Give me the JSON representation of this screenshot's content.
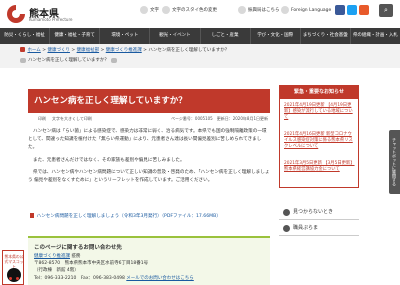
{
  "header": {
    "logo_name": "熊本県",
    "logo_en": "Kumamoto Prefecture",
    "util": [
      "文字",
      "文字のスタイ色の変更",
      "振興局はこちら",
      "Foreign Language"
    ],
    "search_icon": "magnifier-icon"
  },
  "gnav": [
    "防災・くらし・福祉",
    "健康・福祉・子育て",
    "環境・ペット",
    "観光・イベント",
    "しごと・産業",
    "学び・文化・国際",
    "まちづくり・社会基盤",
    "県の組織・計画・入札"
  ],
  "breadcrumb": {
    "items": [
      "ホーム",
      "健康づくり",
      "健康福祉部",
      "健康づくり推進課",
      "ハンセン病を正しく理解していますか？"
    ],
    "share_label": "ハンセン病を正しく理解していますか？"
  },
  "article": {
    "title": "ハンセン病を正しく理解していますか？",
    "meta_left": [
      "印刷",
      "文字を大きくして印刷"
    ],
    "meta_right": [
      "ページ番号：0005105",
      "更新日：2020年8月1日更新"
    ],
    "paragraphs": [
      "ハンセン病は「らい菌」による感染症で、感染力は非常に弱く、治る病気です。本県でも国の強制隔離政策の一環として、間違った知識を植付けた「無らい県運動」により、元患者さん達は長い間偏見差別に苦しめられてきました。",
      "また、元患者さんだけではなく、その家族も差別や偏見に苦しみました。",
      "県では、ハンセン病やハンセン病問題について正しい知識の普及・啓発のため、「ハンセン病を正しく理解しましょう 偏見や差別をなくすために」というリーフレットを作成しています。ご活用ください。"
    ],
    "pdf_link": "ハンセン病問題を正しく理解しましょう（令和3年3月発行）（PDFファイル：17.66MB）"
  },
  "contact": {
    "title": "このページに関するお問い合わせ先",
    "dept": "健康づくり推進課",
    "dept_suffix": "疫務",
    "address": "〒862-8570　熊本県熊本市中央区水前寺6丁目18番1号",
    "building": "（行政棟　新館 4階）",
    "tel": "Tel：096-333-2210　Fax：096-383-0498",
    "mail_link": "メールでのお問い合わせはこちら"
  },
  "sidebar": {
    "emergency_title": "緊急・重要なお知らせ",
    "emergency_items": [
      "2021年4月19日更新 【4月19日更新】感染が流行している地域について",
      "2021年4月16日更新 新型コロナウイルス感染症対策に係る熊本県リスクレベルについて",
      "2021年3月5日更新 【3月5日更新】熊本県経営講協力金について"
    ],
    "links": [
      "見つからないとき",
      "職員ぷらま"
    ]
  },
  "chat_tab": "チャットボットに質問する",
  "pref_banner": "熊本県の公式マスコット",
  "colors": {
    "brand_red": "#c0392b",
    "gnav_bg": "#3a3a3a",
    "link_blue": "#1a5aa0",
    "contact_green": "#9ac23c"
  }
}
